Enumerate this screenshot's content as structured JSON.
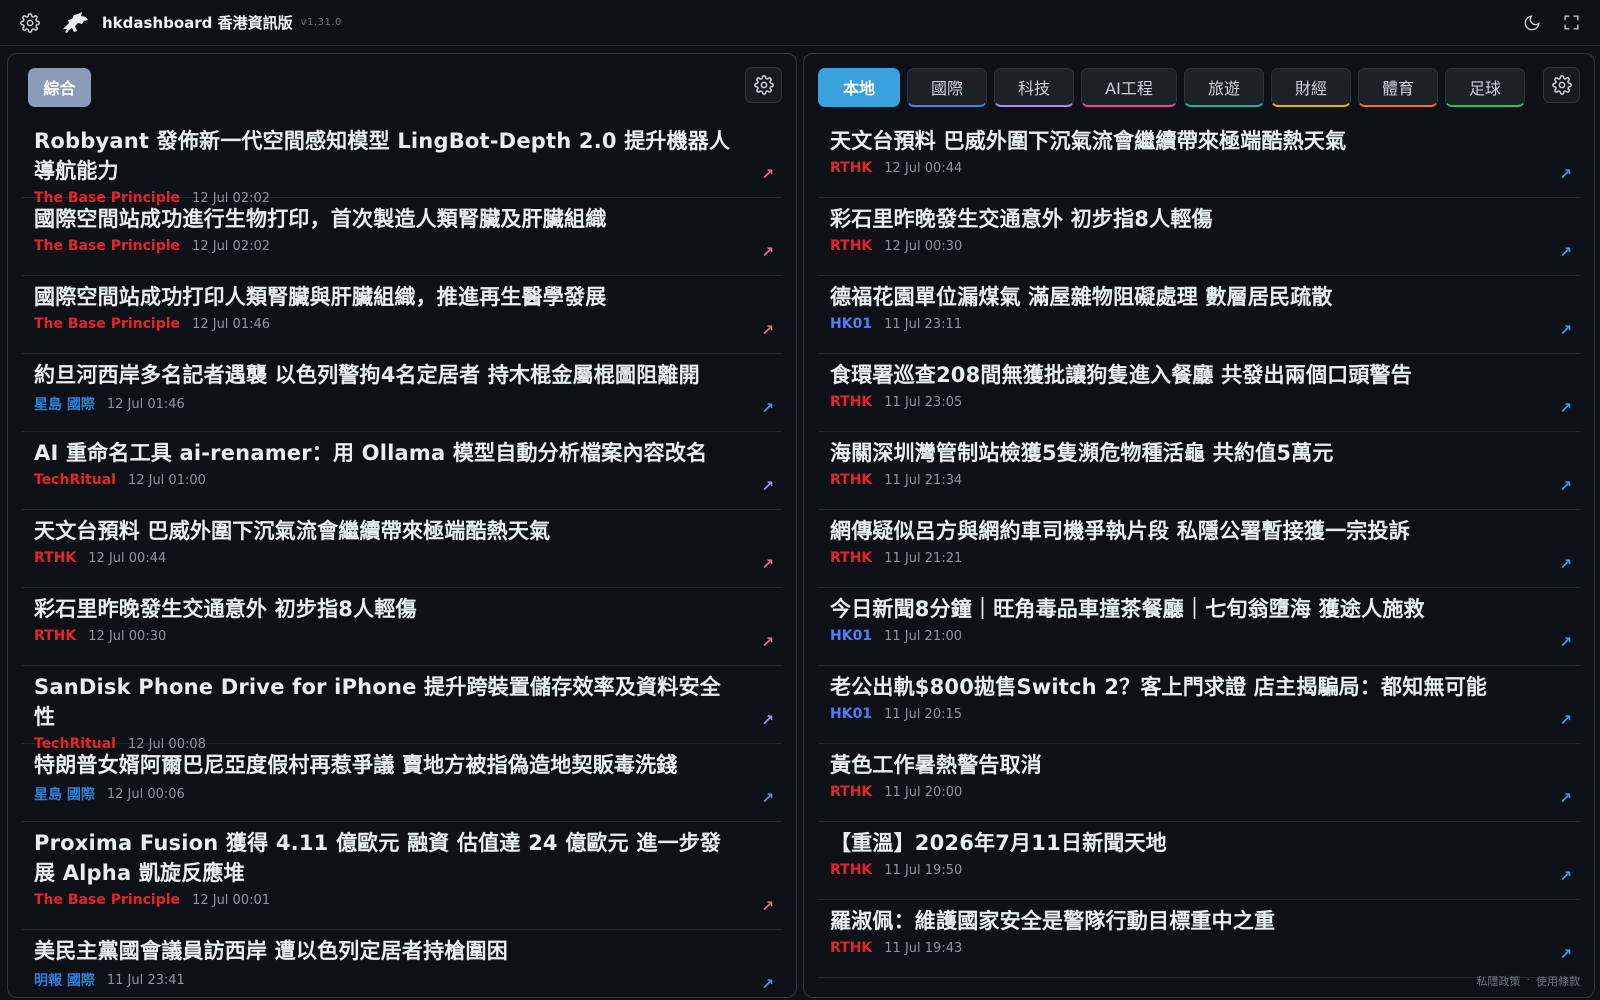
{
  "app": {
    "title": "hkdashboard 香港資訊版",
    "version": "v1.31.0"
  },
  "left_panel": {
    "tab_label": "綜合",
    "items": [
      {
        "title": "Robbyant 發佈新一代空間感知模型 LingBot-Depth 2.0 提升機器人導航能力",
        "source": "The Base Principle",
        "time": "12 Jul 02:02",
        "color": "#e5242a"
      },
      {
        "title": "國際空間站成功進行生物打印，首次製造人類腎臟及肝臟組織",
        "source": "The Base Principle",
        "time": "12 Jul 02:02",
        "color": "#e5242a"
      },
      {
        "title": "國際空間站成功打印人類腎臟與肝臟組織，推進再生醫學發展",
        "source": "The Base Principle",
        "time": "12 Jul 01:46",
        "color": "#e5242a"
      },
      {
        "title": "約旦河西岸多名記者遇襲 以色列警拘4名定居者 持木棍金屬棍圖阻離開",
        "source": "星島 國際",
        "time": "12 Jul 01:46",
        "color": "#2f7fd6"
      },
      {
        "title": "AI 重命名工具 ai-renamer：用 Ollama 模型自動分析檔案內容改名",
        "source": "TechRitual",
        "time": "12 Jul 01:00",
        "color": "#e5242a"
      },
      {
        "title": "天文台預料 巴威外圍下沉氣流會繼續帶來極端酷熱天氣",
        "source": "RTHK",
        "time": "12 Jul 00:44",
        "color": "#e5242a"
      },
      {
        "title": "彩石里昨晚發生交通意外 初步指8人輕傷",
        "source": "RTHK",
        "time": "12 Jul 00:30",
        "color": "#e5242a"
      },
      {
        "title": "SanDisk Phone Drive for iPhone 提升跨裝置儲存效率及資料安全性",
        "source": "TechRitual",
        "time": "12 Jul 00:08",
        "color": "#e5242a"
      },
      {
        "title": "特朗普女婿阿爾巴尼亞度假村再惹爭議 賣地方被指偽造地契販毒洗錢",
        "source": "星島 國際",
        "time": "12 Jul 00:06",
        "color": "#2f7fd6"
      },
      {
        "title": "Proxima Fusion 獲得 4.11 億歐元 融資 估值達 24 億歐元 進一步發展 Alpha 凱旋反應堆",
        "source": "The Base Principle",
        "time": "12 Jul 00:01",
        "color": "#e5242a"
      },
      {
        "title": "美民主黨國會議員訪西岸 遭以色列定居者持槍圍困",
        "source": "明報 國際",
        "time": "11 Jul 23:41",
        "color": "#2f7fd6"
      }
    ]
  },
  "right_panel": {
    "tabs": [
      {
        "label": "本地",
        "accent": "#3aa1dc"
      },
      {
        "label": "國際",
        "accent": "#3b82f6"
      },
      {
        "label": "科技",
        "accent": "#a78bfa"
      },
      {
        "label": "AI工程",
        "accent": "#ec4899"
      },
      {
        "label": "旅遊",
        "accent": "#14b8a6"
      },
      {
        "label": "財經",
        "accent": "#eab308"
      },
      {
        "label": "體育",
        "accent": "#f97316"
      },
      {
        "label": "足球",
        "accent": "#22c55e"
      }
    ],
    "items": [
      {
        "title": "天文台預料 巴威外圍下沉氣流會繼續帶來極端酷熱天氣",
        "source": "RTHK",
        "time": "12 Jul 00:44",
        "color": "#e5242a"
      },
      {
        "title": "彩石里昨晚發生交通意外 初步指8人輕傷",
        "source": "RTHK",
        "time": "12 Jul 00:30",
        "color": "#e5242a"
      },
      {
        "title": "德福花園單位漏煤氣 滿屋雜物阻礙處理 數層居民疏散",
        "source": "HK01",
        "time": "11 Jul 23:11",
        "color": "#4f7cf7"
      },
      {
        "title": "食環署巡查208間無獲批讓狗隻進入餐廳 共發出兩個口頭警告",
        "source": "RTHK",
        "time": "11 Jul 23:05",
        "color": "#e5242a"
      },
      {
        "title": "海關深圳灣管制站檢獲5隻瀕危物種活龜 共約值5萬元",
        "source": "RTHK",
        "time": "11 Jul 21:34",
        "color": "#e5242a"
      },
      {
        "title": "網傳疑似呂方與網約車司機爭執片段 私隱公署暫接獲一宗投訴",
        "source": "RTHK",
        "time": "11 Jul 21:21",
        "color": "#e5242a"
      },
      {
        "title": "今日新聞8分鐘｜旺角毒品車撞茶餐廳｜七旬翁墮海 獲途人施救",
        "source": "HK01",
        "time": "11 Jul 21:00",
        "color": "#4f7cf7"
      },
      {
        "title": "老公出軌$800拋售Switch 2？客上門求證 店主揭騙局：都知無可能",
        "source": "HK01",
        "time": "11 Jul 20:15",
        "color": "#4f7cf7"
      },
      {
        "title": "黃色工作暑熱警告取消",
        "source": "RTHK",
        "time": "11 Jul 20:00",
        "color": "#e5242a"
      },
      {
        "title": "【重溫】2026年7月11日新聞天地",
        "source": "RTHK",
        "time": "11 Jul 19:50",
        "color": "#e5242a"
      },
      {
        "title": "羅淑佩：維護國家安全是警隊行動目標重中之重",
        "source": "RTHK",
        "time": "11 Jul 19:43",
        "color": "#e5242a"
      }
    ]
  },
  "footer": {
    "privacy": "私隱政策",
    "separator": "·",
    "terms": "使用條款"
  },
  "icons": {
    "settings": "gear-icon",
    "logo": "horse-logo",
    "theme": "moon-icon",
    "fullscreen": "fullscreen-icon",
    "external": "arrow-up-right-icon"
  },
  "colors": {
    "background": "#0d1117",
    "active_tab": "#3aa1dc",
    "general_tab": "#8b9bb8"
  }
}
